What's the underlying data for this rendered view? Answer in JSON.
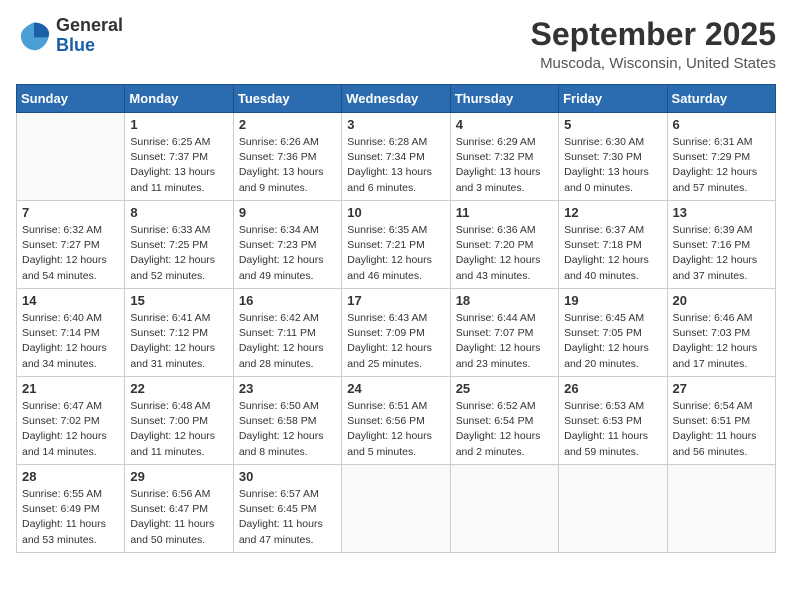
{
  "header": {
    "logo_line1": "General",
    "logo_line2": "Blue",
    "month": "September 2025",
    "location": "Muscoda, Wisconsin, United States"
  },
  "days_of_week": [
    "Sunday",
    "Monday",
    "Tuesday",
    "Wednesday",
    "Thursday",
    "Friday",
    "Saturday"
  ],
  "weeks": [
    [
      {
        "day": "",
        "info": ""
      },
      {
        "day": "1",
        "info": "Sunrise: 6:25 AM\nSunset: 7:37 PM\nDaylight: 13 hours\nand 11 minutes."
      },
      {
        "day": "2",
        "info": "Sunrise: 6:26 AM\nSunset: 7:36 PM\nDaylight: 13 hours\nand 9 minutes."
      },
      {
        "day": "3",
        "info": "Sunrise: 6:28 AM\nSunset: 7:34 PM\nDaylight: 13 hours\nand 6 minutes."
      },
      {
        "day": "4",
        "info": "Sunrise: 6:29 AM\nSunset: 7:32 PM\nDaylight: 13 hours\nand 3 minutes."
      },
      {
        "day": "5",
        "info": "Sunrise: 6:30 AM\nSunset: 7:30 PM\nDaylight: 13 hours\nand 0 minutes."
      },
      {
        "day": "6",
        "info": "Sunrise: 6:31 AM\nSunset: 7:29 PM\nDaylight: 12 hours\nand 57 minutes."
      }
    ],
    [
      {
        "day": "7",
        "info": "Sunrise: 6:32 AM\nSunset: 7:27 PM\nDaylight: 12 hours\nand 54 minutes."
      },
      {
        "day": "8",
        "info": "Sunrise: 6:33 AM\nSunset: 7:25 PM\nDaylight: 12 hours\nand 52 minutes."
      },
      {
        "day": "9",
        "info": "Sunrise: 6:34 AM\nSunset: 7:23 PM\nDaylight: 12 hours\nand 49 minutes."
      },
      {
        "day": "10",
        "info": "Sunrise: 6:35 AM\nSunset: 7:21 PM\nDaylight: 12 hours\nand 46 minutes."
      },
      {
        "day": "11",
        "info": "Sunrise: 6:36 AM\nSunset: 7:20 PM\nDaylight: 12 hours\nand 43 minutes."
      },
      {
        "day": "12",
        "info": "Sunrise: 6:37 AM\nSunset: 7:18 PM\nDaylight: 12 hours\nand 40 minutes."
      },
      {
        "day": "13",
        "info": "Sunrise: 6:39 AM\nSunset: 7:16 PM\nDaylight: 12 hours\nand 37 minutes."
      }
    ],
    [
      {
        "day": "14",
        "info": "Sunrise: 6:40 AM\nSunset: 7:14 PM\nDaylight: 12 hours\nand 34 minutes."
      },
      {
        "day": "15",
        "info": "Sunrise: 6:41 AM\nSunset: 7:12 PM\nDaylight: 12 hours\nand 31 minutes."
      },
      {
        "day": "16",
        "info": "Sunrise: 6:42 AM\nSunset: 7:11 PM\nDaylight: 12 hours\nand 28 minutes."
      },
      {
        "day": "17",
        "info": "Sunrise: 6:43 AM\nSunset: 7:09 PM\nDaylight: 12 hours\nand 25 minutes."
      },
      {
        "day": "18",
        "info": "Sunrise: 6:44 AM\nSunset: 7:07 PM\nDaylight: 12 hours\nand 23 minutes."
      },
      {
        "day": "19",
        "info": "Sunrise: 6:45 AM\nSunset: 7:05 PM\nDaylight: 12 hours\nand 20 minutes."
      },
      {
        "day": "20",
        "info": "Sunrise: 6:46 AM\nSunset: 7:03 PM\nDaylight: 12 hours\nand 17 minutes."
      }
    ],
    [
      {
        "day": "21",
        "info": "Sunrise: 6:47 AM\nSunset: 7:02 PM\nDaylight: 12 hours\nand 14 minutes."
      },
      {
        "day": "22",
        "info": "Sunrise: 6:48 AM\nSunset: 7:00 PM\nDaylight: 12 hours\nand 11 minutes."
      },
      {
        "day": "23",
        "info": "Sunrise: 6:50 AM\nSunset: 6:58 PM\nDaylight: 12 hours\nand 8 minutes."
      },
      {
        "day": "24",
        "info": "Sunrise: 6:51 AM\nSunset: 6:56 PM\nDaylight: 12 hours\nand 5 minutes."
      },
      {
        "day": "25",
        "info": "Sunrise: 6:52 AM\nSunset: 6:54 PM\nDaylight: 12 hours\nand 2 minutes."
      },
      {
        "day": "26",
        "info": "Sunrise: 6:53 AM\nSunset: 6:53 PM\nDaylight: 11 hours\nand 59 minutes."
      },
      {
        "day": "27",
        "info": "Sunrise: 6:54 AM\nSunset: 6:51 PM\nDaylight: 11 hours\nand 56 minutes."
      }
    ],
    [
      {
        "day": "28",
        "info": "Sunrise: 6:55 AM\nSunset: 6:49 PM\nDaylight: 11 hours\nand 53 minutes."
      },
      {
        "day": "29",
        "info": "Sunrise: 6:56 AM\nSunset: 6:47 PM\nDaylight: 11 hours\nand 50 minutes."
      },
      {
        "day": "30",
        "info": "Sunrise: 6:57 AM\nSunset: 6:45 PM\nDaylight: 11 hours\nand 47 minutes."
      },
      {
        "day": "",
        "info": ""
      },
      {
        "day": "",
        "info": ""
      },
      {
        "day": "",
        "info": ""
      },
      {
        "day": "",
        "info": ""
      }
    ]
  ]
}
